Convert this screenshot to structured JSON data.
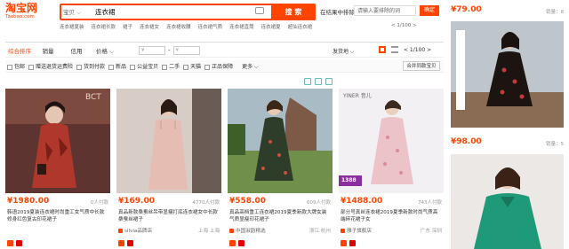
{
  "header": {
    "logo": "淘宝网",
    "logo_sub": "Taobao.com",
    "search_tab": "宝贝 ⌵",
    "search_query": "连衣裙",
    "search_button": "搜 索",
    "store_label": "在结果中排除",
    "store_placeholder": "请输入要排除的词",
    "store_button": "确定",
    "hot_words": [
      "连衣裙夏装",
      "连衣裙长款",
      "裙子",
      "连衣裙女",
      "连衣裙收腰",
      "连衣裙气质",
      "连衣裙直筒",
      "连衣裙夏",
      "超仙连衣裙",
      "连衣裙"
    ],
    "pager": "< 1/100 >"
  },
  "sort": {
    "tabs": [
      "综合排序",
      "销量",
      "信用",
      "价格 ⌵"
    ],
    "price_from": "¥",
    "price_to": "¥",
    "ship_to": "发货地 ⌵",
    "page_small": "< 1/100 >"
  },
  "options": [
    "包邮",
    "赠送退货运费险",
    "货到付款",
    "新品",
    "公益宝贝",
    "二手",
    "天猫",
    "正品保障"
  ],
  "options_more": "更多 ⌵",
  "compare_button": "合并同款宝贝",
  "items": [
    {
      "price": "¥1980.00",
      "sold": "0人付款",
      "title": "韩语2019夏装连衣裙时尚重工女气质中长款修身红色复古印花裙子",
      "shop": "",
      "location": "",
      "colors": {
        "bg": "#6e3b37",
        "dress": "#b0372b"
      }
    },
    {
      "price": "¥169.00",
      "sold": "4770人付款",
      "title": "真品新款桑蚕丝吊带显瘦打底连衣裙女中长款桑蚕丝裙子",
      "shop": "silvia品牌店",
      "location": "上海 上海",
      "colors": {
        "bg": "#dccfc9",
        "dress": "#e7c2b9"
      }
    },
    {
      "price": "¥558.00",
      "sold": "609人付款",
      "title": "真品高档重工连衣裙2019夏季新款大牌女装气质显瘦印花裙子",
      "shop": "中国淑韵精选",
      "location": "浙江 杭州",
      "colors": {
        "bg": "#9fb3bf",
        "dress": "#2d3d2a"
      }
    },
    {
      "price": "¥1488.00",
      "sold": "743人付款",
      "title": "部分号真丝连衣裙2019夏季新款时尚气质高端碎花裙子女",
      "shop": "雅子旗舰店",
      "location": "广东 深圳",
      "colors": {
        "bg": "#f1eef3",
        "dress": "#ecbdc5"
      }
    }
  ],
  "item_badge": "1388",
  "item_brand": "YINER 音儿",
  "right_col": {
    "top_price": "¥79.00",
    "top_sold": "销量：8",
    "mid_price": "¥98.00",
    "mid_sold": "销量：5"
  }
}
